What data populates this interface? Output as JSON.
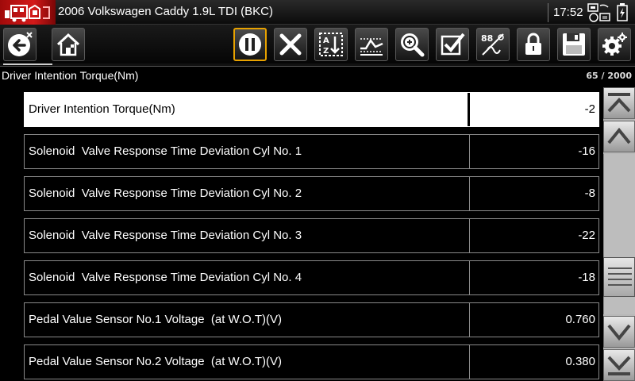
{
  "titlebar": {
    "vehicle": "2006 Volkswagen Caddy 1.9L TDI (BKC)",
    "time": "17:52"
  },
  "toolbar": {
    "buttons": [
      {
        "name": "back-exit",
        "icon": "back-arrow-icon"
      },
      {
        "name": "home",
        "icon": "home-icon"
      },
      {
        "name": "pause",
        "icon": "pause-icon",
        "active": true
      },
      {
        "name": "clear",
        "icon": "close-icon"
      },
      {
        "name": "sort",
        "icon": "sort-az-icon"
      },
      {
        "name": "graph",
        "icon": "graph-icon"
      },
      {
        "name": "zoom",
        "icon": "zoom-icon"
      },
      {
        "name": "select",
        "icon": "checkbox-icon"
      },
      {
        "name": "units",
        "icon": "units-icon"
      },
      {
        "name": "lock",
        "icon": "lock-icon"
      },
      {
        "name": "save",
        "icon": "save-icon"
      },
      {
        "name": "settings",
        "icon": "gear-icon"
      }
    ]
  },
  "header": {
    "title": "Driver Intention Torque(Nm)",
    "counter": "65 / 2000"
  },
  "rows": [
    {
      "name": "Driver Intention Torque(Nm)",
      "value": "-2",
      "selected": true
    },
    {
      "name": "Solenoid  Valve Response Time Deviation Cyl No. 1",
      "value": "-16"
    },
    {
      "name": "Solenoid  Valve Response Time Deviation Cyl No. 2",
      "value": "-8"
    },
    {
      "name": "Solenoid  Valve Response Time Deviation Cyl No. 3",
      "value": "-22"
    },
    {
      "name": "Solenoid  Valve Response Time Deviation Cyl No. 4",
      "value": "-18"
    },
    {
      "name": "Pedal Value Sensor No.1 Voltage  (at W.O.T)(V)",
      "value": "0.760"
    },
    {
      "name": "Pedal Value Sensor No.2 Voltage  (at W.O.T)(V)",
      "value": "0.380"
    }
  ],
  "scrollbar": {
    "position": 0.64,
    "buttons": [
      "scroll-top-icon",
      "scroll-up-icon",
      "scroll-down-icon",
      "scroll-bottom-icon"
    ]
  },
  "colors": {
    "logo_red": "#c41414",
    "active_border": "#e8a200",
    "row_border": "#8a8a8a"
  }
}
